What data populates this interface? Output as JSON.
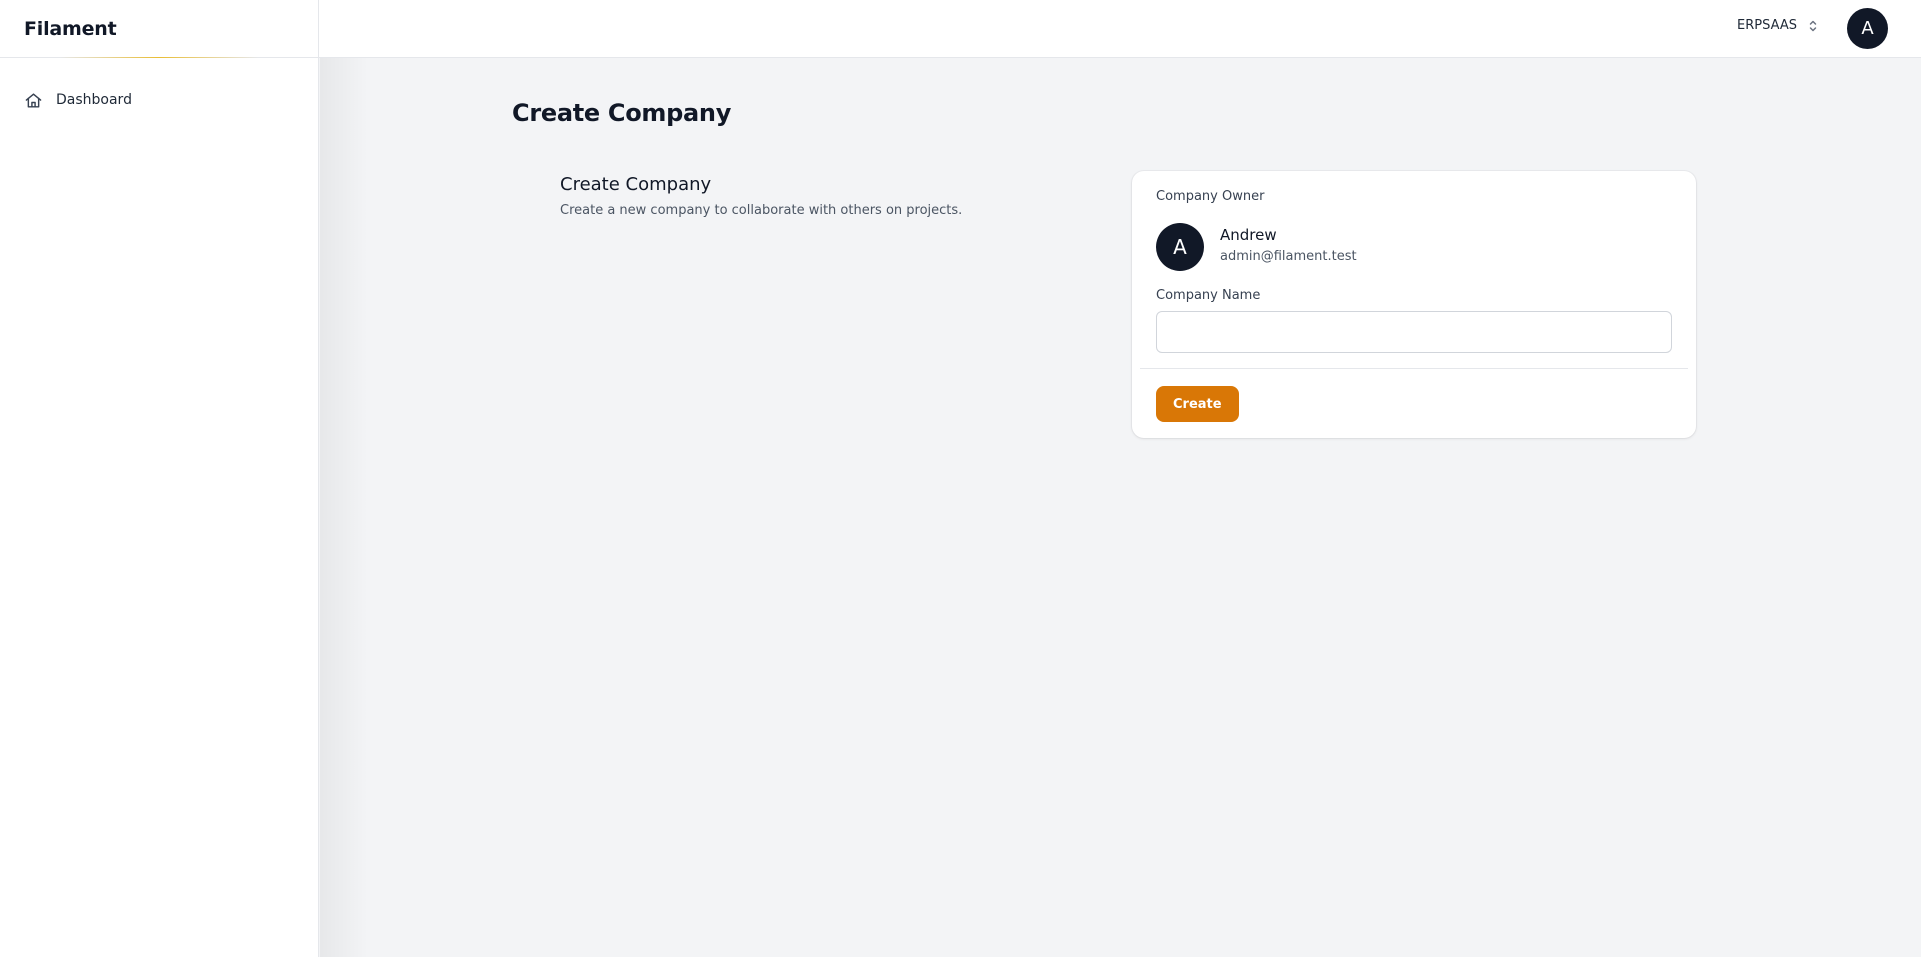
{
  "app": {
    "brand": "Filament"
  },
  "sidebar": {
    "items": [
      {
        "label": "Dashboard",
        "icon": "home-icon"
      }
    ]
  },
  "topbar": {
    "team_name": "ERPSAAS",
    "team_switch_icon": "chevron-up-down-icon",
    "user_initial": "A"
  },
  "page": {
    "title": "Create Company"
  },
  "section": {
    "title": "Create Company",
    "description": "Create a new company to collaborate with others on projects."
  },
  "form": {
    "owner_label": "Company Owner",
    "owner": {
      "initial": "A",
      "name": "Andrew",
      "email": "admin@filament.test"
    },
    "company_name_label": "Company Name",
    "company_name_value": "",
    "submit_label": "Create"
  },
  "colors": {
    "accent": "#d97706",
    "avatar_bg": "#111827",
    "page_bg": "#f3f4f6"
  }
}
